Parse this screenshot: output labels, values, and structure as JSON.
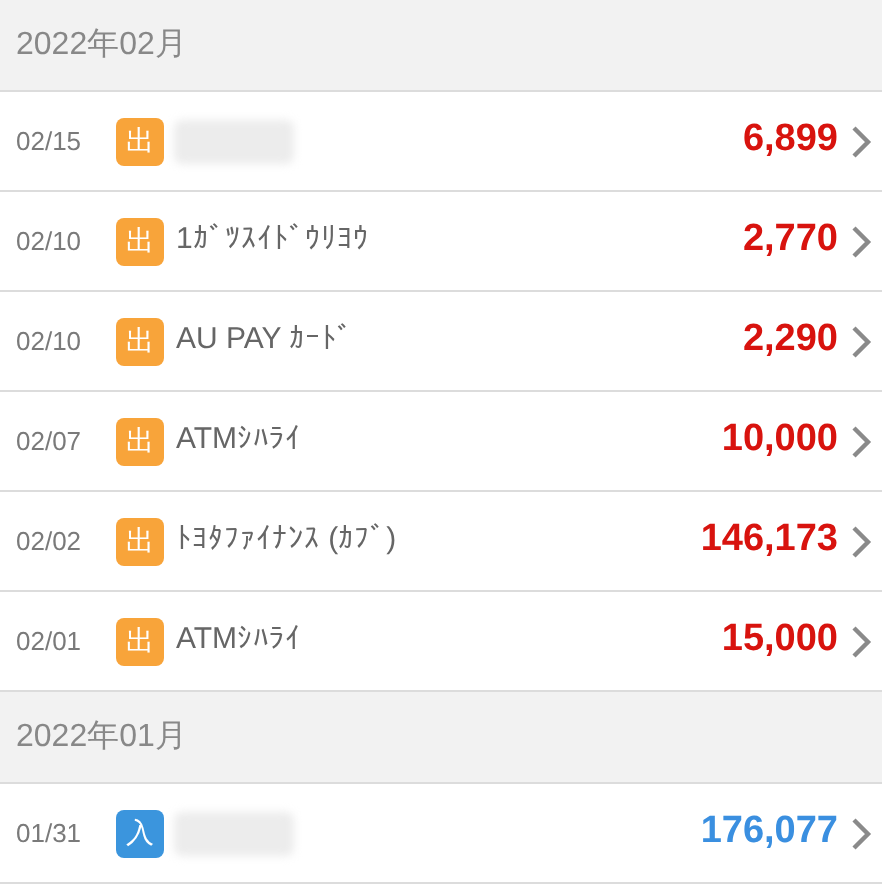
{
  "sections": [
    {
      "month": "2022年02月",
      "entries": [
        {
          "date": "02/15",
          "kind": "out",
          "badge": "出",
          "description_hidden": true,
          "amount": "6,899"
        },
        {
          "date": "02/10",
          "kind": "out",
          "badge": "出",
          "description_hidden": false,
          "description": "1ｶﾞﾂｽｲﾄﾞｳﾘﾖｳ",
          "amount": "2,770"
        },
        {
          "date": "02/10",
          "kind": "out",
          "badge": "出",
          "description_hidden": false,
          "description": "AU PAY ｶｰﾄﾞ",
          "amount": "2,290"
        },
        {
          "date": "02/07",
          "kind": "out",
          "badge": "出",
          "description_hidden": false,
          "description": "ATMｼﾊﾗｲ",
          "amount": "10,000"
        },
        {
          "date": "02/02",
          "kind": "out",
          "badge": "出",
          "description_hidden": false,
          "description": "ﾄﾖﾀﾌｧｲﾅﾝｽ (ｶﾌﾞ)",
          "amount": "146,173"
        },
        {
          "date": "02/01",
          "kind": "out",
          "badge": "出",
          "description_hidden": false,
          "description": "ATMｼﾊﾗｲ",
          "amount": "15,000"
        }
      ]
    },
    {
      "month": "2022年01月",
      "entries": [
        {
          "date": "01/31",
          "kind": "in",
          "badge": "入",
          "description_hidden": true,
          "amount": "176,077"
        }
      ]
    }
  ]
}
